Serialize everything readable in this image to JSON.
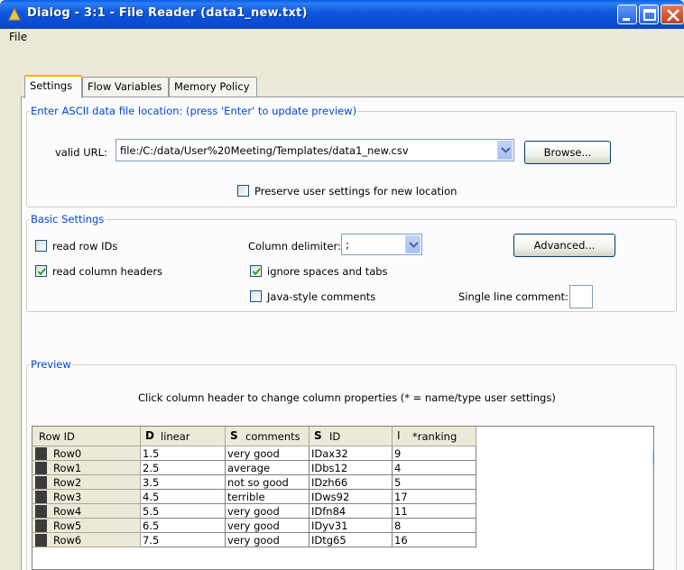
{
  "window": {
    "title": "Dialog - 3:1 - File Reader (data1_new.txt)",
    "colors": {
      "titlebar": "#0A5FE8",
      "accent_tab": "#FFB000",
      "group_label": "#0046D5"
    }
  },
  "menu": {
    "file": "File"
  },
  "tabs": [
    {
      "label": "Settings",
      "active": true
    },
    {
      "label": "Flow Variables",
      "active": false
    },
    {
      "label": "Memory Policy",
      "active": false
    }
  ],
  "location": {
    "group_label": "Enter ASCII data file location: (press 'Enter' to update preview)",
    "url_label": "valid URL:",
    "url_value": "file:/C:/data/User%20Meeting/Templates/data1_new.csv",
    "browse_label": "Browse...",
    "preserve_label": "Preserve user settings for new location",
    "preserve_checked": false
  },
  "basic": {
    "group_label": "Basic Settings",
    "read_row_ids": {
      "label": "read row IDs",
      "checked": false
    },
    "read_column_headers": {
      "label": "read column headers",
      "checked": true
    },
    "column_delimiter_label": "Column delimiter:",
    "column_delimiter_value": ";",
    "ignore_spaces": {
      "label": "ignore spaces and tabs",
      "checked": true
    },
    "java_comments": {
      "label": "Java-style comments",
      "checked": false
    },
    "single_line_comment_label": "Single line comment:",
    "advanced_label": "Advanced..."
  },
  "preview": {
    "group_label": "Preview",
    "note": "Click column header to change column properties (* = name/type user settings)",
    "row_id_header": "Row ID",
    "columns": [
      {
        "type_icon": "D",
        "name": "linear"
      },
      {
        "type_icon": "S",
        "name": "comments"
      },
      {
        "type_icon": "S",
        "name": "ID"
      },
      {
        "type_icon": "I",
        "name": "*ranking"
      }
    ],
    "rows": [
      {
        "id": "Row0",
        "cells": [
          "1.5",
          "very good",
          "IDax32",
          "9"
        ]
      },
      {
        "id": "Row1",
        "cells": [
          "2.5",
          "average",
          "IDbs12",
          "4"
        ]
      },
      {
        "id": "Row2",
        "cells": [
          "3.5",
          "not so good",
          "IDzh66",
          "5"
        ]
      },
      {
        "id": "Row3",
        "cells": [
          "4.5",
          "terrible",
          "IDws92",
          "17"
        ]
      },
      {
        "id": "Row4",
        "cells": [
          "5.5",
          "very good",
          "IDfn84",
          "11"
        ]
      },
      {
        "id": "Row5",
        "cells": [
          "6.5",
          "very good",
          "IDyv31",
          "8"
        ]
      },
      {
        "id": "Row6",
        "cells": [
          "7.5",
          "very good",
          "IDtg65",
          "16"
        ]
      }
    ]
  }
}
